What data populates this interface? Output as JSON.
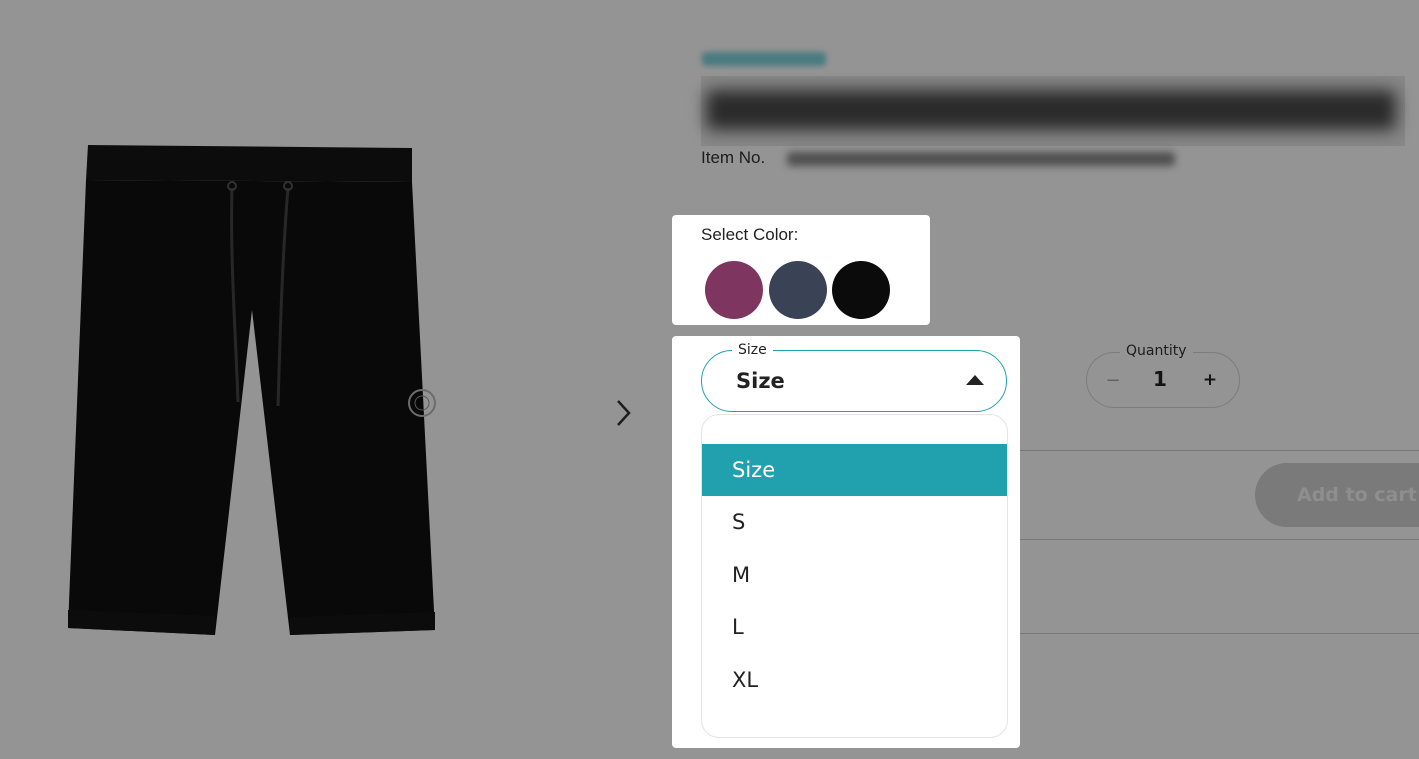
{
  "product": {
    "item_no_label": "Item No.",
    "image_icon": "black-shorts-image"
  },
  "color": {
    "label": "Select Color:",
    "swatches": [
      {
        "name": "purple",
        "hex": "#7e3560"
      },
      {
        "name": "navy",
        "hex": "#3a4256"
      },
      {
        "name": "black",
        "hex": "#0b0b0b"
      }
    ]
  },
  "size": {
    "legend": "Size",
    "selected": "Size",
    "options": [
      "Size",
      "S",
      "M",
      "L",
      "XL"
    ],
    "accent": "#21a1ad"
  },
  "quantity": {
    "label": "Quantity",
    "minus": "−",
    "value": "1",
    "plus": "+"
  },
  "cart": {
    "add_label": "Add to cart"
  },
  "nav": {
    "next_icon": "chevron-right-icon"
  }
}
